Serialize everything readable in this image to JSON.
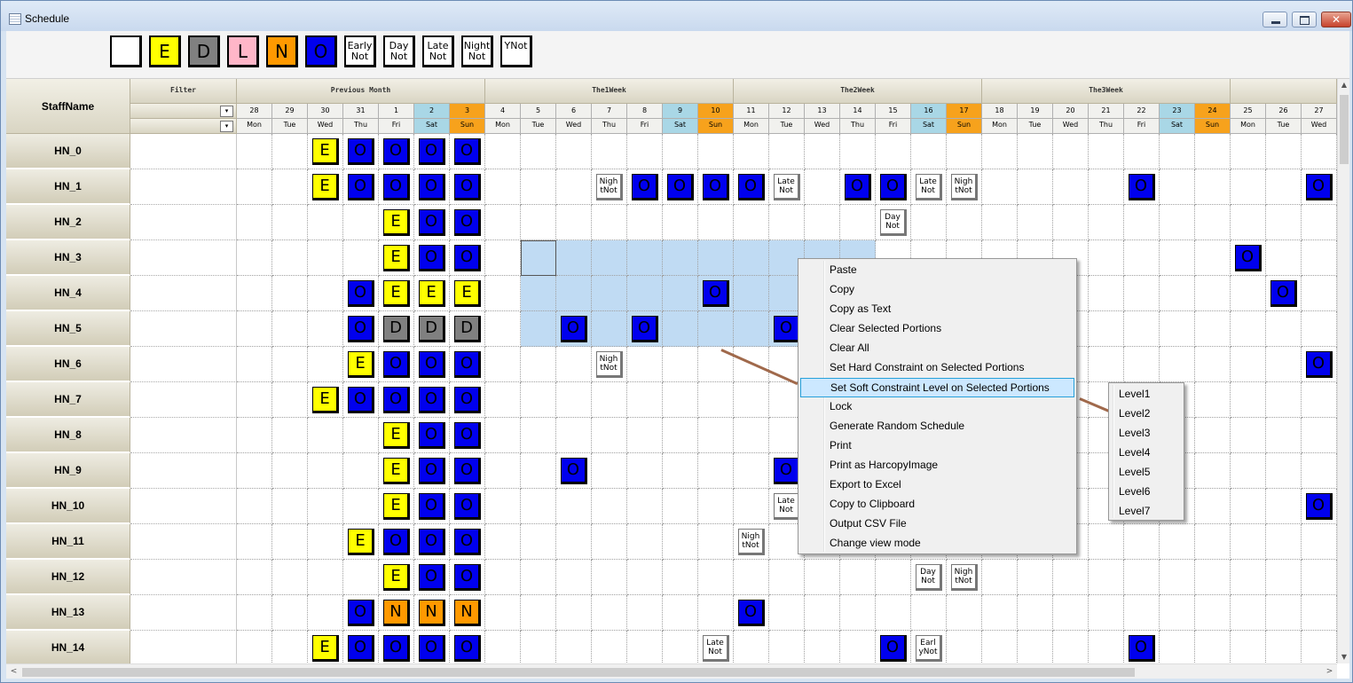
{
  "window": {
    "title": "Schedule",
    "min_glyph": "",
    "max_glyph": "",
    "close_glyph": "✕"
  },
  "toolbar": {
    "buttons": [
      {
        "label": "",
        "color": "#ffffff"
      },
      {
        "label": "E",
        "color": "#ffff00"
      },
      {
        "label": "D",
        "color": "#808080"
      },
      {
        "label": "L",
        "color": "#ffb6c8"
      },
      {
        "label": "N",
        "color": "#ff9900"
      },
      {
        "label": "O",
        "color": "#0000ee"
      },
      {
        "label": "Early\nNot",
        "color": "#ffffff"
      },
      {
        "label": "Day\nNot",
        "color": "#ffffff"
      },
      {
        "label": "Late\nNot",
        "color": "#ffffff"
      },
      {
        "label": "Night\nNot",
        "color": "#ffffff"
      },
      {
        "label": "YNot",
        "color": "#ffffff"
      }
    ]
  },
  "header": {
    "staff_name": "StaffName",
    "filter": "Filter",
    "groups": [
      {
        "label": "Previous Month",
        "span": 7
      },
      {
        "label": "The1Week",
        "span": 7
      },
      {
        "label": "The2Week",
        "span": 7
      },
      {
        "label": "The3Week",
        "span": 7
      },
      {
        "label": "",
        "span": 3
      }
    ],
    "dates": [
      "28",
      "29",
      "30",
      "31",
      "1",
      "2",
      "3",
      "4",
      "5",
      "6",
      "7",
      "8",
      "9",
      "10",
      "11",
      "12",
      "13",
      "14",
      "15",
      "16",
      "17",
      "18",
      "19",
      "20",
      "21",
      "22",
      "23",
      "24",
      "25",
      "26",
      "27"
    ],
    "weekdays": [
      "Mon",
      "Tue",
      "Wed",
      "Thu",
      "Fri",
      "Sat",
      "Sun",
      "Mon",
      "Tue",
      "Wed",
      "Thu",
      "Fri",
      "Sat",
      "Sun",
      "Mon",
      "Tue",
      "Wed",
      "Thu",
      "Fri",
      "Sat",
      "Sun",
      "Mon",
      "Tue",
      "Wed",
      "Thu",
      "Fri",
      "Sat",
      "Sun",
      "Mon",
      "Tue",
      "Wed"
    ],
    "dropdown_glyph": "▾"
  },
  "rows": [
    {
      "name": "HN_0",
      "cells": [
        "",
        "",
        "E",
        "O",
        "O",
        "O",
        "O",
        "",
        "",
        "",
        "",
        "",
        "",
        "",
        "",
        "",
        "",
        "",
        "",
        "",
        "",
        "",
        "",
        "",
        "",
        "",
        "",
        "",
        "",
        "",
        ""
      ]
    },
    {
      "name": "HN_1",
      "cells": [
        "",
        "",
        "E",
        "O",
        "O",
        "O",
        "O",
        "",
        "",
        "",
        "Nigh\ntNot",
        "O",
        "O",
        "O",
        "O",
        "Late\nNot",
        "",
        "O",
        "O",
        "Late\nNot",
        "Nigh\ntNot",
        "",
        "",
        "",
        "",
        "O",
        "",
        "",
        "",
        "",
        "O"
      ]
    },
    {
      "name": "HN_2",
      "cells": [
        "",
        "",
        "",
        "",
        "E",
        "O",
        "O",
        "",
        "",
        "",
        "",
        "",
        "",
        "",
        "",
        "",
        "",
        "",
        "Day\nNot",
        "",
        "",
        "",
        "",
        "",
        "",
        "",
        "",
        "",
        "",
        "",
        ""
      ]
    },
    {
      "name": "HN_3",
      "cells": [
        "",
        "",
        "",
        "",
        "E",
        "O",
        "O",
        "",
        "",
        "",
        "",
        "",
        "",
        "",
        "",
        "",
        "",
        "",
        "",
        "",
        "",
        "",
        "",
        "",
        "",
        "",
        "",
        "",
        "O",
        "",
        ""
      ]
    },
    {
      "name": "HN_4",
      "cells": [
        "",
        "",
        "",
        "O",
        "E",
        "E",
        "E",
        "",
        "",
        "",
        "",
        "",
        "",
        "O",
        "",
        "",
        "",
        "",
        "",
        "",
        "",
        "",
        "",
        "",
        "",
        "",
        "",
        "",
        "",
        "O",
        ""
      ]
    },
    {
      "name": "HN_5",
      "cells": [
        "",
        "",
        "",
        "O",
        "D",
        "D",
        "D",
        "",
        "",
        "O",
        "",
        "O",
        "",
        "",
        "",
        "O",
        "",
        "",
        "",
        "",
        "",
        "",
        "",
        "",
        "",
        "",
        "",
        "",
        "",
        "",
        ""
      ]
    },
    {
      "name": "HN_6",
      "cells": [
        "",
        "",
        "",
        "E",
        "O",
        "O",
        "O",
        "",
        "",
        "",
        "Nigh\ntNot",
        "",
        "",
        "",
        "",
        "",
        "",
        "",
        "",
        "",
        "",
        "",
        "",
        "",
        "",
        "",
        "",
        "",
        "",
        "",
        "O"
      ]
    },
    {
      "name": "HN_7",
      "cells": [
        "",
        "",
        "E",
        "O",
        "O",
        "O",
        "O",
        "",
        "",
        "",
        "",
        "",
        "",
        "",
        "",
        "",
        "",
        "",
        "",
        "",
        "",
        "",
        "",
        "",
        "",
        "",
        "",
        "",
        "",
        "",
        ""
      ]
    },
    {
      "name": "HN_8",
      "cells": [
        "",
        "",
        "",
        "",
        "E",
        "O",
        "O",
        "",
        "",
        "",
        "",
        "",
        "",
        "",
        "",
        "",
        "",
        "",
        "",
        "",
        "",
        "",
        "",
        "",
        "",
        "",
        "",
        "",
        "",
        "",
        ""
      ]
    },
    {
      "name": "HN_9",
      "cells": [
        "",
        "",
        "",
        "",
        "E",
        "O",
        "O",
        "",
        "",
        "O",
        "",
        "",
        "",
        "",
        "",
        "O",
        "",
        "",
        "",
        "",
        "",
        "",
        "",
        "",
        "",
        "",
        "",
        "",
        "",
        "",
        ""
      ]
    },
    {
      "name": "HN_10",
      "cells": [
        "",
        "",
        "",
        "",
        "E",
        "O",
        "O",
        "",
        "",
        "",
        "",
        "",
        "",
        "",
        "",
        "Late\nNot",
        "",
        "",
        "",
        "",
        "",
        "",
        "",
        "",
        "",
        "",
        "",
        "",
        "",
        "",
        "O"
      ]
    },
    {
      "name": "HN_11",
      "cells": [
        "",
        "",
        "",
        "E",
        "O",
        "O",
        "O",
        "",
        "",
        "",
        "",
        "",
        "",
        "",
        "Nigh\ntNot",
        "",
        "",
        "",
        "",
        "",
        "",
        "",
        "",
        "",
        "",
        "",
        "",
        "",
        "",
        "",
        ""
      ]
    },
    {
      "name": "HN_12",
      "cells": [
        "",
        "",
        "",
        "",
        "E",
        "O",
        "O",
        "",
        "",
        "",
        "",
        "",
        "",
        "",
        "",
        "",
        "",
        "",
        "",
        "Day\nNot",
        "Nigh\ntNot",
        "",
        "",
        "",
        "",
        "",
        "",
        "",
        "",
        "",
        ""
      ]
    },
    {
      "name": "HN_13",
      "cells": [
        "",
        "",
        "",
        "O",
        "N",
        "N",
        "N",
        "",
        "",
        "",
        "",
        "",
        "",
        "",
        "O",
        "",
        "",
        "",
        "",
        "",
        "",
        "",
        "",
        "",
        "",
        "",
        "",
        "",
        "",
        "",
        ""
      ]
    },
    {
      "name": "HN_14",
      "cells": [
        "",
        "",
        "E",
        "O",
        "O",
        "O",
        "O",
        "",
        "",
        "",
        "",
        "",
        "",
        "Late\nNot",
        "",
        "",
        "",
        "",
        "O",
        "Earl\nyNot",
        "",
        "",
        "",
        "",
        "",
        "O",
        "",
        "",
        "",
        "",
        ""
      ]
    }
  ],
  "selection": {
    "row_start": 3,
    "row_end": 5,
    "col_start": 8,
    "col_end": 17
  },
  "context_menu": {
    "items": [
      "Paste",
      "Copy",
      "Copy as Text",
      "Clear Selected Portions",
      "Clear All",
      "Set Hard Constraint  on Selected Portions",
      "Set Soft Constraint Level on Selected Portions",
      "Lock",
      "Generate Random Schedule",
      "Print",
      "Print as HarcopyImage",
      "Export to Excel",
      "Copy to Clipboard",
      "Output CSV File",
      "Change view mode"
    ],
    "highlighted": 6
  },
  "submenu": {
    "items": [
      "Level1",
      "Level2",
      "Level3",
      "Level4",
      "Level5",
      "Level6",
      "Level7"
    ]
  },
  "scroll": {
    "up": "▲",
    "down": "▼",
    "left": "<",
    "right": ">"
  },
  "colors": {
    "O": "#0000ee",
    "E": "#ffff00",
    "D": "#808080",
    "N": "#ff9900",
    "sat": "#a9d7e6",
    "sun": "#f7a21c",
    "selection": "#c0dbf3"
  }
}
